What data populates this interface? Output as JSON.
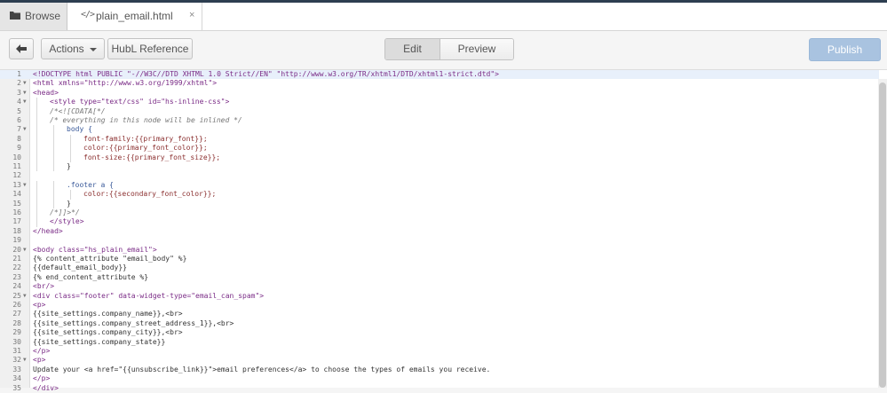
{
  "tabs": {
    "browse": {
      "label": "Browse",
      "icon": "folder-icon"
    },
    "file": {
      "label": "plain_email.html",
      "icon": "code-icon",
      "close": "×"
    }
  },
  "toolbar": {
    "back_icon": "arrow-left-icon",
    "actions_label": "Actions",
    "hubl_label": "HubL Reference",
    "edit_label": "Edit",
    "preview_label": "Preview",
    "publish_label": "Publish"
  },
  "editor": {
    "lines": [
      {
        "n": "1",
        "fold": false,
        "indent": 0,
        "text": "<!DOCTYPE html PUBLIC \"-//W3C//DTD XHTML 1.0 Strict//EN\" \"http://www.w3.org/TR/xhtml1/DTD/xhtml1-strict.dtd\">",
        "kind": "tag"
      },
      {
        "n": "2",
        "fold": true,
        "indent": 0,
        "text": "<html xmlns=\"http://www.w3.org/1999/xhtml\">",
        "kind": "tag"
      },
      {
        "n": "3",
        "fold": true,
        "indent": 0,
        "text": "<head>",
        "kind": "tag"
      },
      {
        "n": "4",
        "fold": true,
        "indent": 1,
        "text": "<style type=\"text/css\" id=\"hs-inline-css\">",
        "kind": "tag"
      },
      {
        "n": "5",
        "fold": false,
        "indent": 1,
        "text": "/*<![CDATA[*/",
        "kind": "com"
      },
      {
        "n": "6",
        "fold": false,
        "indent": 1,
        "text": "/* everything in this node will be inlined */",
        "kind": "com"
      },
      {
        "n": "7",
        "fold": true,
        "indent": 2,
        "text": "body {",
        "kind": "sel"
      },
      {
        "n": "8",
        "fold": false,
        "indent": 3,
        "text": "font-family:{{primary_font}};",
        "kind": "prop"
      },
      {
        "n": "9",
        "fold": false,
        "indent": 3,
        "text": "color:{{primary_font_color}};",
        "kind": "prop"
      },
      {
        "n": "10",
        "fold": false,
        "indent": 3,
        "text": "font-size:{{primary_font_size}};",
        "kind": "prop"
      },
      {
        "n": "11",
        "fold": false,
        "indent": 2,
        "text": "}",
        "kind": "plain"
      },
      {
        "n": "12",
        "fold": false,
        "indent": 0,
        "text": "",
        "kind": "plain"
      },
      {
        "n": "13",
        "fold": true,
        "indent": 2,
        "text": ".footer a {",
        "kind": "sel"
      },
      {
        "n": "14",
        "fold": false,
        "indent": 3,
        "text": "color:{{secondary_font_color}};",
        "kind": "prop"
      },
      {
        "n": "15",
        "fold": false,
        "indent": 2,
        "text": "}",
        "kind": "plain"
      },
      {
        "n": "16",
        "fold": false,
        "indent": 1,
        "text": "/*]]>*/",
        "kind": "com"
      },
      {
        "n": "17",
        "fold": false,
        "indent": 1,
        "text": "</style>",
        "kind": "tag"
      },
      {
        "n": "18",
        "fold": false,
        "indent": 0,
        "text": "</head>",
        "kind": "tag"
      },
      {
        "n": "19",
        "fold": false,
        "indent": 0,
        "text": "",
        "kind": "plain"
      },
      {
        "n": "20",
        "fold": true,
        "indent": 0,
        "text": "<body class=\"hs_plain_email\">",
        "kind": "tag"
      },
      {
        "n": "21",
        "fold": false,
        "indent": 0,
        "text": "{% content_attribute \"email_body\" %}",
        "kind": "plain"
      },
      {
        "n": "22",
        "fold": false,
        "indent": 0,
        "text": "{{default_email_body}}",
        "kind": "plain"
      },
      {
        "n": "23",
        "fold": false,
        "indent": 0,
        "text": "{% end_content_attribute %}",
        "kind": "plain"
      },
      {
        "n": "24",
        "fold": false,
        "indent": 0,
        "text": "<br/>",
        "kind": "tag"
      },
      {
        "n": "25",
        "fold": true,
        "indent": 0,
        "text": "<div class=\"footer\" data-widget-type=\"email_can_spam\">",
        "kind": "tag"
      },
      {
        "n": "26",
        "fold": false,
        "indent": 0,
        "text": "<p>",
        "kind": "tag"
      },
      {
        "n": "27",
        "fold": false,
        "indent": 0,
        "text": "{{site_settings.company_name}},<br>",
        "kind": "mixed"
      },
      {
        "n": "28",
        "fold": false,
        "indent": 0,
        "text": "{{site_settings.company_street_address_1}},<br>",
        "kind": "mixed"
      },
      {
        "n": "29",
        "fold": false,
        "indent": 0,
        "text": "{{site_settings.company_city}},<br>",
        "kind": "mixed"
      },
      {
        "n": "30",
        "fold": false,
        "indent": 0,
        "text": "{{site_settings.company_state}}",
        "kind": "plain"
      },
      {
        "n": "31",
        "fold": false,
        "indent": 0,
        "text": "</p>",
        "kind": "tag"
      },
      {
        "n": "32",
        "fold": true,
        "indent": 0,
        "text": "<p>",
        "kind": "tag"
      },
      {
        "n": "33",
        "fold": false,
        "indent": 0,
        "text": "Update your <a href=\"{{unsubscribe_link}}\">email preferences</a> to choose the types of emails you receive.",
        "kind": "mixed"
      },
      {
        "n": "34",
        "fold": false,
        "indent": 0,
        "text": "</p>",
        "kind": "tag"
      },
      {
        "n": "35",
        "fold": false,
        "indent": 0,
        "text": "</div>",
        "kind": "tag"
      }
    ]
  },
  "colors": {
    "top_bar": "#2d3e50",
    "publish_bg": "#a9c3e0",
    "active_line": "#e8f0fb"
  }
}
